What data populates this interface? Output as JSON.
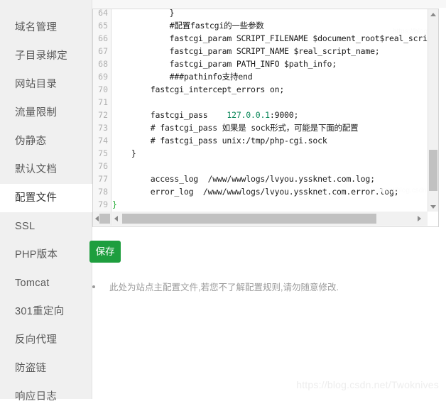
{
  "sidebar": {
    "items": [
      {
        "label": "域名管理",
        "active": false
      },
      {
        "label": "子目录绑定",
        "active": false
      },
      {
        "label": "网站目录",
        "active": false
      },
      {
        "label": "流量限制",
        "active": false
      },
      {
        "label": "伪静态",
        "active": false
      },
      {
        "label": "默认文档",
        "active": false
      },
      {
        "label": "配置文件",
        "active": true
      },
      {
        "label": "SSL",
        "active": false
      },
      {
        "label": "PHP版本",
        "active": false
      },
      {
        "label": "Tomcat",
        "active": false
      },
      {
        "label": "301重定向",
        "active": false
      },
      {
        "label": "反向代理",
        "active": false
      },
      {
        "label": "防盗链",
        "active": false
      },
      {
        "label": "响应日志",
        "active": false
      }
    ]
  },
  "editor": {
    "first_line_number": 64,
    "lines": [
      {
        "num": 64,
        "text": "            }"
      },
      {
        "num": 65,
        "text": "            #配置fastcgi的一些参数"
      },
      {
        "num": 66,
        "text": "            fastcgi_param SCRIPT_FILENAME $document_root$real_script_name;"
      },
      {
        "num": 67,
        "text": "            fastcgi_param SCRIPT_NAME $real_script_name;"
      },
      {
        "num": 68,
        "text": "            fastcgi_param PATH_INFO $path_info;"
      },
      {
        "num": 69,
        "text": "            ###pathinfo支持end"
      },
      {
        "num": 70,
        "text": "        fastcgi_intercept_errors on;"
      },
      {
        "num": 71,
        "text": ""
      },
      {
        "num": 72,
        "text": "        fastcgi_pass    127.0.0.1:9000;",
        "highlight": "127.0.0.1"
      },
      {
        "num": 73,
        "text": "        # fastcgi_pass 如果是 sock形式，可能是下面的配置"
      },
      {
        "num": 74,
        "text": "        # fastcgi_pass unix:/tmp/php-cgi.sock"
      },
      {
        "num": 75,
        "text": "    }"
      },
      {
        "num": 76,
        "text": ""
      },
      {
        "num": 77,
        "text": "        access_log  /www/wwwlogs/lvyou.yssknet.com.log;"
      },
      {
        "num": 78,
        "text": "        error_log  /www/wwwlogs/lvyou.yssknet.com.error.log;"
      },
      {
        "num": 79,
        "text": "}",
        "green": true
      }
    ]
  },
  "actions": {
    "save_label": "保存"
  },
  "notes": {
    "text": "此处为站点主配置文件,若您不了解配置规则,请勿随意修改."
  },
  "watermark": {
    "text": "https://blog.csdn.net/Twoknives"
  },
  "colors": {
    "accent_green": "#1e9e3e",
    "sidebar_bg": "#f0f0f0",
    "sidebar_active_bg": "#ffffff",
    "string_token": "#098658",
    "brace_green": "#22aa33",
    "note_text": "#9b9b9b"
  }
}
